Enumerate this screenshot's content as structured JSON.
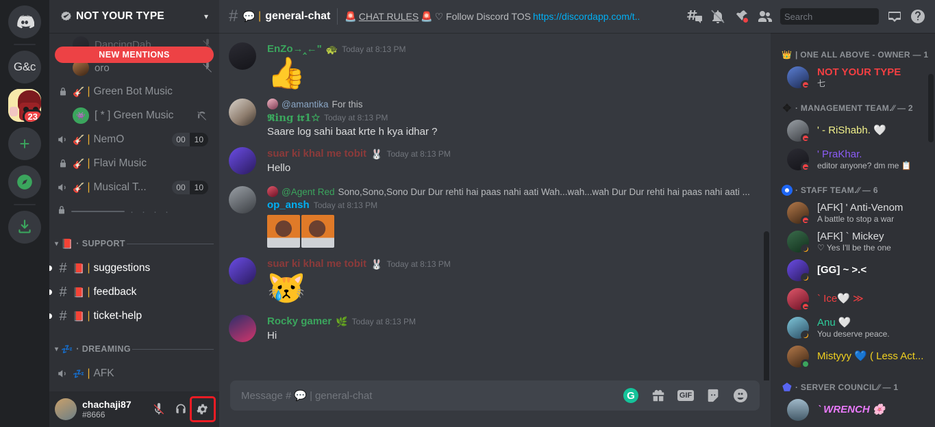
{
  "server_rail": {
    "items": [
      {
        "name": "discord-home",
        "label": "",
        "type": "home"
      },
      {
        "name": "server-gc",
        "label": "G&c",
        "type": "text"
      },
      {
        "name": "server-not-your-type",
        "label": "",
        "type": "image",
        "badge": "23",
        "active": true
      },
      {
        "name": "add-server",
        "label": "+",
        "type": "plus"
      },
      {
        "name": "explore-servers",
        "label": "",
        "type": "compass"
      },
      {
        "name": "download-apps",
        "label": "",
        "type": "download"
      }
    ]
  },
  "sidebar": {
    "guild_name": "NOT YOUR TYPE",
    "new_mentions_label": "NEW MENTIONS",
    "voice_members": [
      {
        "name": "DancingDab",
        "muted": true
      },
      {
        "name": "oro",
        "muted": true
      }
    ],
    "channels": [
      {
        "type": "locked-voice",
        "emoji": "🎸",
        "name": "Green Bot Music",
        "unread": false
      },
      {
        "type": "bot-member",
        "emoji": "",
        "name": "[ * ] Green Music",
        "unread": false
      },
      {
        "type": "voice",
        "emoji": "🎸",
        "name": "NemO",
        "count_a": "00",
        "count_b": "10",
        "unread": false
      },
      {
        "type": "locked-voice",
        "emoji": "🎸",
        "name": "Flavi Music",
        "unread": false
      },
      {
        "type": "voice",
        "emoji": "🎸",
        "name": "Musical T...",
        "count_a": "00",
        "count_b": "10",
        "unread": false
      },
      {
        "type": "locked-hidden",
        "emoji": "",
        "name": "",
        "unread": false
      }
    ],
    "categories": [
      {
        "emoji": "📕",
        "name": "SUPPORT",
        "channels": [
          {
            "type": "text",
            "emoji": "📕",
            "name": "suggestions",
            "unread": true
          },
          {
            "type": "text",
            "emoji": "📕",
            "name": "feedback",
            "unread": true
          },
          {
            "type": "text",
            "emoji": "📕",
            "name": "ticket-help",
            "unread": true
          }
        ]
      },
      {
        "emoji": "💤",
        "name": "DREAMING",
        "channels": [
          {
            "type": "voice",
            "emoji": "💤",
            "name": "AFK",
            "unread": false
          }
        ]
      }
    ],
    "user_panel": {
      "username": "chachaji87",
      "discriminator": "#8666",
      "mute_label": "Mute",
      "deafen_label": "Deafen",
      "settings_label": "User Settings"
    }
  },
  "header": {
    "channel_name": "general-chat",
    "channel_emoji": "💬",
    "topic_prefix": "CHAT RULES",
    "topic_emoji": "🚨",
    "topic_text": "♡ Follow Discord TOS",
    "topic_link": "https://discordapp.com/t...",
    "search_placeholder": "Search",
    "tools": [
      "threads-icon",
      "notifications-off-icon",
      "pinned-messages-icon",
      "member-list-icon",
      "inbox-icon",
      "help-icon"
    ]
  },
  "messages": [
    {
      "author": "EnZo→‸←\"",
      "author_color": "#3ba55d",
      "badge": "🐢",
      "timestamp": "Today at 8:13 PM",
      "content": "👍",
      "big_emoji": true,
      "avatar": "art-dark"
    },
    {
      "reply": {
        "user": "@amantika",
        "text": "For this",
        "avatar": "art-pink"
      },
      "author": "𝕽ing 𝖙𝖗1☆",
      "author_color": "#3ba55d",
      "timestamp": "Today at 8:13 PM",
      "content": "Saare log sahi baat krte h kya idhar ?",
      "avatar": "art-anime2"
    },
    {
      "author": "suar ki khal me tobit",
      "author_color": "#8b3a3a",
      "badge": "🐰",
      "timestamp": "Today at 8:13 PM",
      "content": "Hello",
      "avatar": "art-anime3"
    },
    {
      "reply": {
        "user": "@Agent Red",
        "text": "Sono,Sono,Sono Dur Dur rehti hai paas nahi aati Wah...wah...wah Dur Dur rehti hai paas nahi aati ...",
        "avatar": "art-red"
      },
      "author": "op_ansh",
      "author_color": "#00aff4",
      "timestamp": "Today at 8:13 PM",
      "content": "",
      "attachments": [
        "boy-photo-1",
        "boy-photo-2"
      ],
      "avatar": "art-gray"
    },
    {
      "author": "suar ki khal me tobit",
      "author_color": "#8b3a3a",
      "badge": "🐰",
      "timestamp": "Today at 8:13 PM",
      "content": "😿",
      "big_emoji": true,
      "avatar": "art-anime3"
    },
    {
      "author": "Rocky gamer",
      "author_color": "#3ba55d",
      "badge": "🌿",
      "timestamp": "Today at 8:13 PM",
      "content": "Hi",
      "avatar": "art-squid"
    }
  ],
  "composer": {
    "placeholder_prefix": "Message #",
    "placeholder_emoji": "💬",
    "placeholder_name": "general-chat",
    "icons": [
      "grammarly-icon",
      "gift-icon",
      "gif-icon",
      "sticker-icon",
      "emoji-icon"
    ],
    "gif_label": "GIF"
  },
  "members": {
    "groups": [
      {
        "icon": "crown-icon",
        "label": "| ONE ALL ABOVE - OWNER — 1",
        "members": [
          {
            "name": "NOT YOUR TYPE",
            "color": "#f23f42",
            "sub": "七",
            "status": "dnd",
            "avatar": "art-blue"
          }
        ]
      },
      {
        "icon": "diamond-icon",
        "label": "· MANAGEMENT TEAM.⁄⁄ — 2",
        "members": [
          {
            "name": "' - RiShabh. 🤍",
            "color": "#f0f08a",
            "sub": "",
            "status": "dnd",
            "avatar": "art-gray"
          },
          {
            "name": "' PraKhar.",
            "color": "#8b5cf6",
            "sub": "editor anyone? dm me 📋",
            "status": "dnd",
            "avatar": "art-dark"
          }
        ]
      },
      {
        "icon": "user-circle-icon",
        "label": "· STAFF TEAM.⁄⁄ — 6",
        "members": [
          {
            "name": "[AFK] ' Anti-Venom",
            "color": "#dcddde",
            "sub": "A battle to stop a war",
            "status": "dnd",
            "avatar": "art-brown"
          },
          {
            "name": "[AFK] ` Mickey",
            "color": "#dcddde",
            "sub": "♡  Yes I'll be the one",
            "status": "idle",
            "avatar": "art-green"
          },
          {
            "name": "[GG] ~ >.<",
            "color": "#ffffff",
            "sub": "",
            "status": "idle",
            "avatar": "art-anime3"
          },
          {
            "name": "` Ice🤍 ≫",
            "color": "#f23f42",
            "sub": "",
            "status": "dnd",
            "avatar": "art-red"
          },
          {
            "name": "Anu 🤍",
            "color": "#2ecc9b",
            "sub": "You deserve peace.",
            "status": "idle",
            "avatar": "art-teal"
          },
          {
            "name": "Mistyyy 💙 ( Less Act...",
            "color": "#f0d020",
            "sub": "",
            "status": "online",
            "avatar": "art-brown"
          }
        ]
      },
      {
        "icon": "shield-icon",
        "label": "· SERVER COUNCIL⁄⁄ — 1",
        "members": [
          {
            "name": "` WRENCH 🌸",
            "color": "#e879f9",
            "sub": "",
            "status": "",
            "avatar": "art-wave"
          }
        ]
      }
    ]
  }
}
